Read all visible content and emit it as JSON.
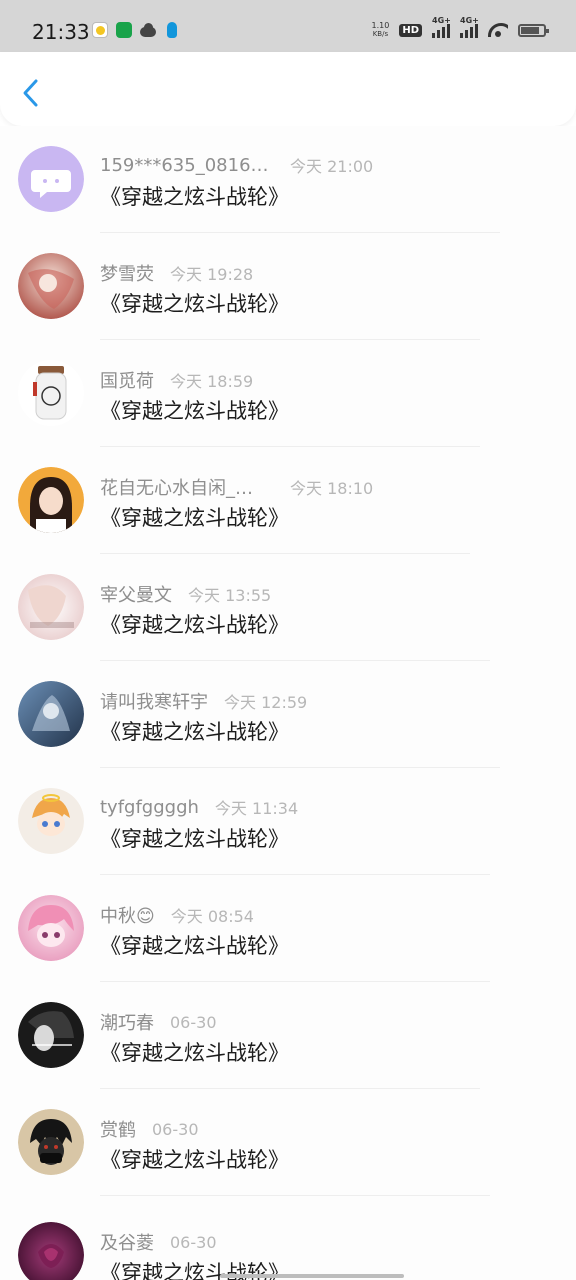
{
  "status_bar": {
    "time": "21:33",
    "net_speed_value": "1.10",
    "net_speed_unit": "KB/s",
    "hd_label": "HD",
    "signal_1_label": "4G+",
    "signal_2_label": "4G+"
  },
  "header": {
    "back_icon": "chevron-left-icon",
    "accent_color": "#2a98e8"
  },
  "messages": [
    {
      "name": "159***635_0816…",
      "time": "今天 21:00",
      "text": "《穿越之炫斗战轮》"
    },
    {
      "name": "梦雪荧",
      "time": "今天 19:28",
      "text": "《穿越之炫斗战轮》"
    },
    {
      "name": "国觅荷",
      "time": "今天 18:59",
      "text": "《穿越之炫斗战轮》"
    },
    {
      "name": "花自无心水自闲_…",
      "time": "今天 18:10",
      "text": "《穿越之炫斗战轮》"
    },
    {
      "name": "宰父曼文",
      "time": "今天 13:55",
      "text": "《穿越之炫斗战轮》"
    },
    {
      "name": "请叫我寒轩宇",
      "time": "今天 12:59",
      "text": "《穿越之炫斗战轮》"
    },
    {
      "name": "tyfgfggggh",
      "time": "今天 11:34",
      "text": "《穿越之炫斗战轮》"
    },
    {
      "name": "中秋😊",
      "time": "今天 08:54",
      "text": "《穿越之炫斗战轮》"
    },
    {
      "name": "潮巧春",
      "time": "06-30",
      "text": "《穿越之炫斗战轮》"
    },
    {
      "name": "赏鹤",
      "time": "06-30",
      "text": "《穿越之炫斗战轮》"
    },
    {
      "name": "及谷菱",
      "time": "06-30",
      "text": "《穿越之炫斗战轮》"
    }
  ]
}
